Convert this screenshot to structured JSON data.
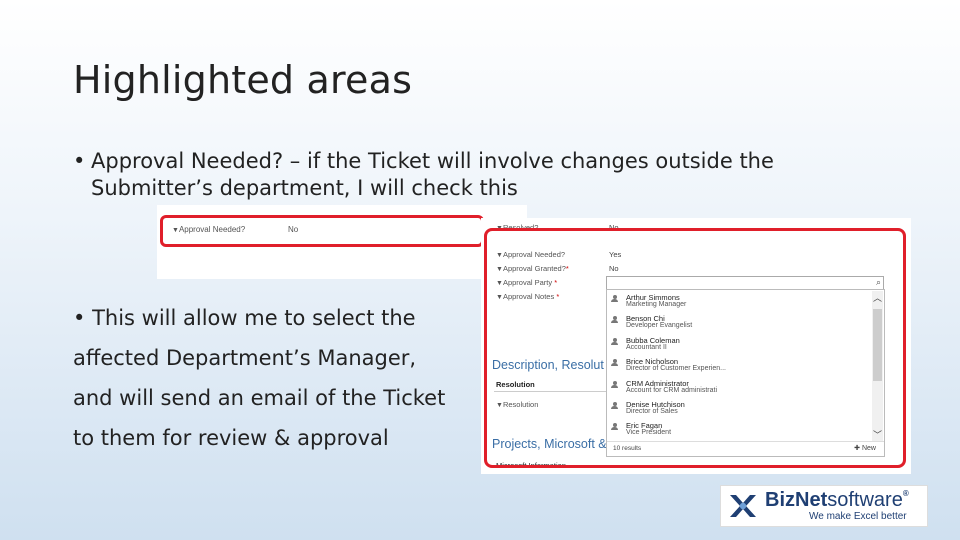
{
  "slide": {
    "title": "Highlighted areas",
    "bullet1": {
      "bullet": "•",
      "line1": "Approval Needed? – if the Ticket will involve changes outside the",
      "line2": "Submitter’s department, I will check this"
    },
    "bullet2": {
      "bullet": "•",
      "lines": [
        "This will allow me to select the",
        "affected Department’s Manager,",
        "and will send an email of the Ticket",
        "to them for review & approval"
      ]
    }
  },
  "screenshot_small": {
    "label": "Approval Needed?",
    "value": "No"
  },
  "screenshot_large": {
    "fields": [
      {
        "label": "Resolved?",
        "value": "No"
      },
      {
        "label": "Approval Needed?",
        "value": "Yes"
      },
      {
        "label": "Approval Granted?",
        "value": "No"
      },
      {
        "label": "Approval Party",
        "value": ""
      },
      {
        "label": "Approval Notes",
        "value": ""
      }
    ],
    "section1": "Description, Resolut",
    "resolution_head": "Resolution",
    "resolution_label": "Resolution",
    "section2": "Projects, Microsoft &",
    "section2_sub": "Microsoft Information",
    "lookup": {
      "items": [
        {
          "name": "Arthur Simmons",
          "title": "Marketing Manager"
        },
        {
          "name": "Benson Chi",
          "title": "Developer Evangelist"
        },
        {
          "name": "Bubba Coleman",
          "title": "Accountant II"
        },
        {
          "name": "Brice Nicholson",
          "title": "Director of Customer Experien..."
        },
        {
          "name": "CRM Administrator",
          "title": "Account for CRM administrati"
        },
        {
          "name": "Denise Hutchison",
          "title": "Director of Sales"
        },
        {
          "name": "Eric Fagan",
          "title": "Vice President"
        }
      ],
      "results": "10 results",
      "new_label": "New",
      "icons": {
        "search": "search-icon",
        "up": "chevron-up-icon",
        "down": "chevron-down-icon",
        "person": "person-icon"
      }
    }
  },
  "logo": {
    "name_bold": "BizNet",
    "name_light": "software",
    "registered": "®",
    "tagline": "We make Excel better"
  },
  "colors": {
    "highlight": "#e01f2a",
    "section": "#3a6ea5",
    "brand": "#1f3f73"
  }
}
